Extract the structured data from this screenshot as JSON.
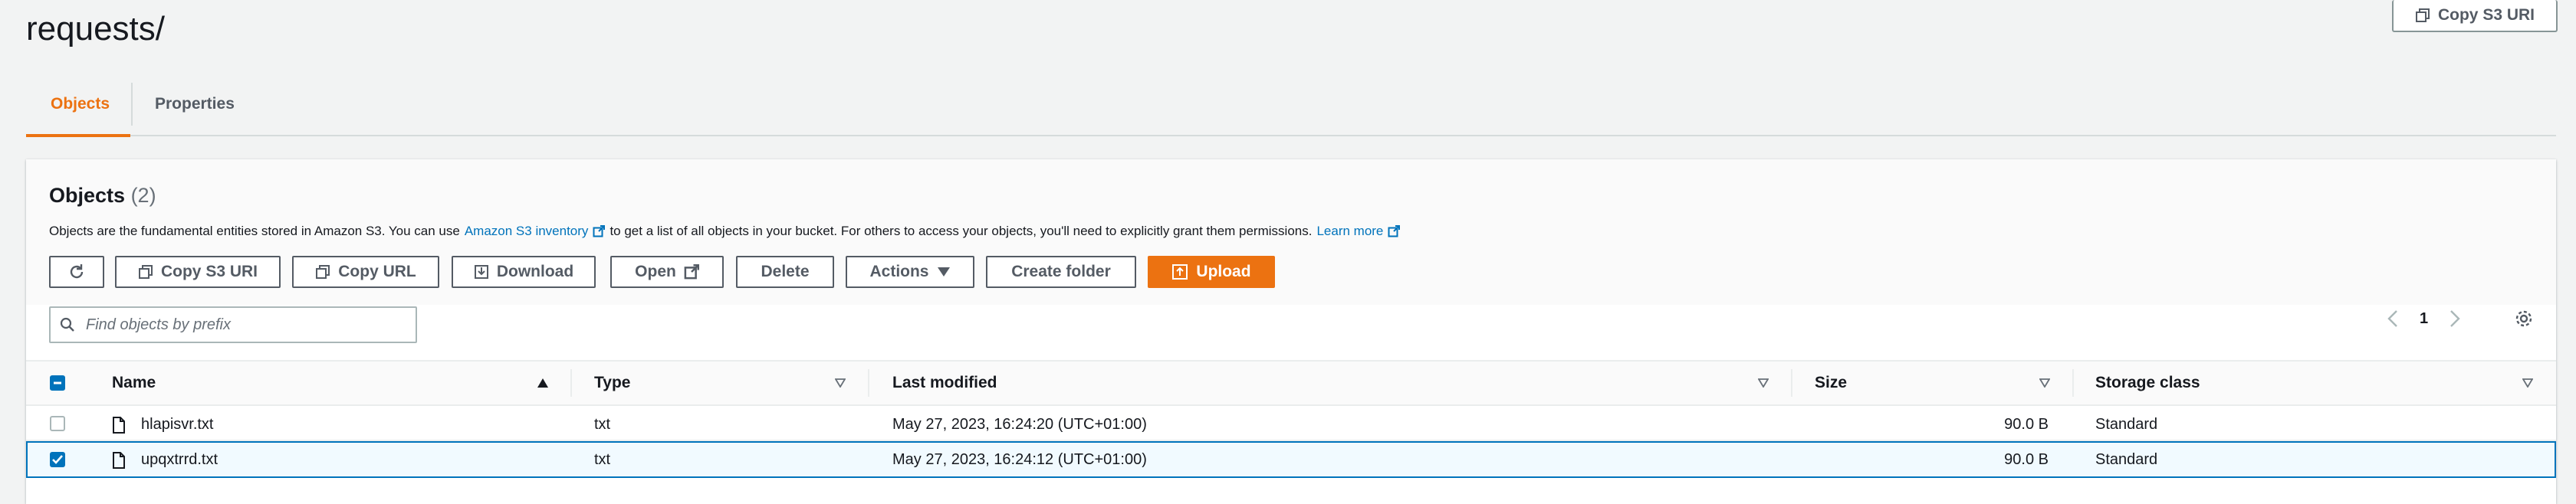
{
  "page": {
    "title": "requests/",
    "copy_s3_uri": "Copy S3 URI"
  },
  "tabs": [
    {
      "label": "Objects"
    },
    {
      "label": "Properties"
    }
  ],
  "objects": {
    "title": "Objects",
    "count": "(2)",
    "description": {
      "part1": "Objects are the fundamental entities stored in Amazon S3. You can use",
      "inventory_link": "Amazon S3 inventory",
      "part2": "to get a list of all objects in your bucket. For others to access your objects, you'll need to explicitly grant them permissions.",
      "learn_more": "Learn more"
    }
  },
  "toolbar": {
    "copy_s3_uri": "Copy S3 URI",
    "copy_url": "Copy URL",
    "download": "Download",
    "open": "Open",
    "delete": "Delete",
    "actions": "Actions",
    "create_folder": "Create folder",
    "upload": "Upload"
  },
  "search": {
    "placeholder": "Find objects by prefix"
  },
  "pagination": {
    "page": "1"
  },
  "table": {
    "columns": [
      "Name",
      "Type",
      "Last modified",
      "Size",
      "Storage class"
    ],
    "rows": [
      {
        "name": "hlapisvr.txt",
        "type": "txt",
        "last_modified": "May 27, 2023, 16:24:20 (UTC+01:00)",
        "size": "90.0 B",
        "storage_class": "Standard",
        "selected": false
      },
      {
        "name": "upqxtrrd.txt",
        "type": "txt",
        "last_modified": "May 27, 2023, 16:24:12 (UTC+01:00)",
        "size": "90.0 B",
        "storage_class": "Standard",
        "selected": true
      }
    ]
  },
  "colors": {
    "accent": "#ec7211",
    "link": "#0073bb",
    "text": "#16191f",
    "muted": "#545b64"
  }
}
